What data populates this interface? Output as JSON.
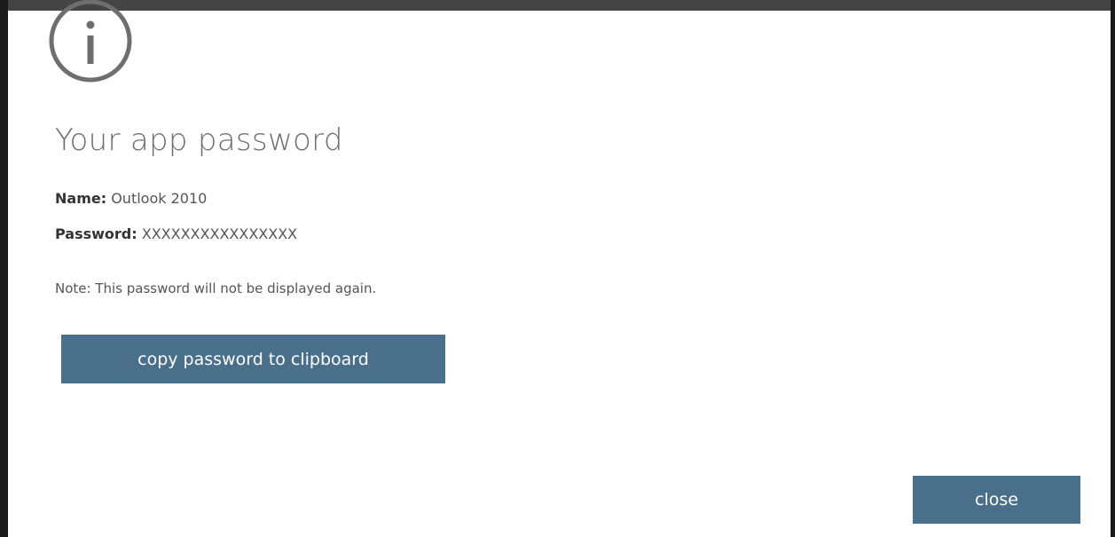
{
  "dialog": {
    "icon": "info-icon",
    "title": "Your app password",
    "name_label": "Name:",
    "name_value": "Outlook 2010",
    "password_label": "Password:",
    "password_value": "XXXXXXXXXXXXXXXX",
    "note": "Note: This password will not be displayed again.",
    "copy_button_label": "copy password to clipboard",
    "close_button_label": "close"
  },
  "colors": {
    "button_bg": "#4a6f8a",
    "button_text": "#ffffff",
    "title_text": "#6e6e6e",
    "icon_stroke": "#6e6e6e",
    "frame": "#1a1a1a"
  }
}
